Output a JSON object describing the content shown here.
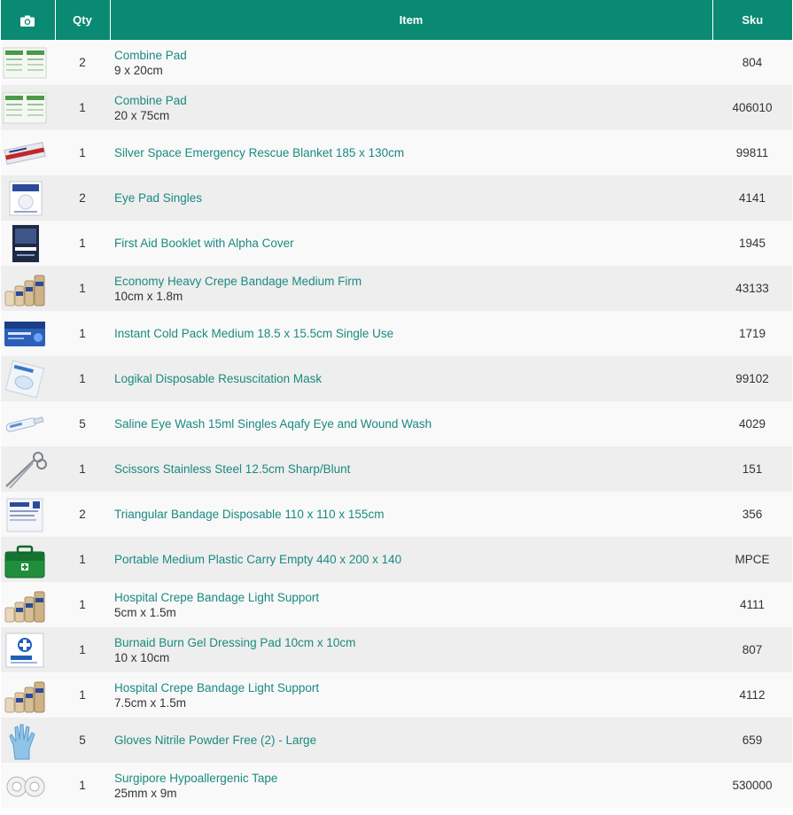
{
  "header": {
    "photo_icon": "camera-icon",
    "qty_label": "Qty",
    "item_label": "Item",
    "sku_label": "Sku"
  },
  "colors": {
    "header_bg": "#0a8a72",
    "link": "#1a8a80",
    "row_odd": "#f9f9f9",
    "row_even": "#eeeeee"
  },
  "rows": [
    {
      "thumb": "combine-pad-thumbnail",
      "qty": "2",
      "name": "Combine Pad",
      "sub": "9 x 20cm",
      "sku": "804"
    },
    {
      "thumb": "combine-pad-thumbnail",
      "qty": "1",
      "name": "Combine Pad",
      "sub": "20 x 75cm",
      "sku": "406010"
    },
    {
      "thumb": "space-blanket-thumbnail",
      "qty": "1",
      "name": "Silver Space Emergency Rescue Blanket 185 x 130cm",
      "sub": "",
      "sku": "99811"
    },
    {
      "thumb": "eye-pad-thumbnail",
      "qty": "2",
      "name": "Eye Pad Singles",
      "sub": "",
      "sku": "4141"
    },
    {
      "thumb": "first-aid-booklet-thumbnail",
      "qty": "1",
      "name": "First Aid Booklet with Alpha Cover",
      "sub": "",
      "sku": "1945"
    },
    {
      "thumb": "crepe-bandage-thumbnail",
      "qty": "1",
      "name": "Economy Heavy Crepe Bandage Medium Firm",
      "sub": "10cm x 1.8m",
      "sku": "43133"
    },
    {
      "thumb": "cold-pack-thumbnail",
      "qty": "1",
      "name": "Instant Cold Pack Medium 18.5 x 15.5cm Single Use",
      "sub": "",
      "sku": "1719"
    },
    {
      "thumb": "resuscitation-mask-thumbnail",
      "qty": "1",
      "name": "Logikal Disposable Resuscitation Mask",
      "sub": "",
      "sku": "99102"
    },
    {
      "thumb": "eye-wash-thumbnail",
      "qty": "5",
      "name": "Saline Eye Wash 15ml Singles Aqafy Eye and Wound Wash",
      "sub": "",
      "sku": "4029"
    },
    {
      "thumb": "scissors-thumbnail",
      "qty": "1",
      "name": "Scissors Stainless Steel 12.5cm Sharp/Blunt",
      "sub": "",
      "sku": "151"
    },
    {
      "thumb": "triangular-bandage-thumbnail",
      "qty": "2",
      "name": "Triangular Bandage Disposable 110 x 110 x 155cm",
      "sub": "",
      "sku": "356"
    },
    {
      "thumb": "carry-case-thumbnail",
      "qty": "1",
      "name": "Portable Medium Plastic Carry Empty 440 x 200 x 140",
      "sub": "",
      "sku": "MPCE"
    },
    {
      "thumb": "crepe-bandage-thumbnail",
      "qty": "1",
      "name": "Hospital Crepe Bandage Light Support",
      "sub": "5cm x 1.5m",
      "sku": "4111"
    },
    {
      "thumb": "burn-gel-thumbnail",
      "qty": "1",
      "name": "Burnaid Burn Gel Dressing Pad 10cm x 10cm",
      "sub": "10 x 10cm",
      "sku": "807"
    },
    {
      "thumb": "crepe-bandage-thumbnail",
      "qty": "1",
      "name": "Hospital Crepe Bandage Light Support",
      "sub": "7.5cm x 1.5m",
      "sku": "4112"
    },
    {
      "thumb": "gloves-thumbnail",
      "qty": "5",
      "name": "Gloves Nitrile Powder Free (2) - Large",
      "sub": "",
      "sku": "659"
    },
    {
      "thumb": "tape-thumbnail",
      "qty": "1",
      "name": "Surgipore Hypoallergenic Tape",
      "sub": "25mm x 9m",
      "sku": "530000"
    }
  ]
}
